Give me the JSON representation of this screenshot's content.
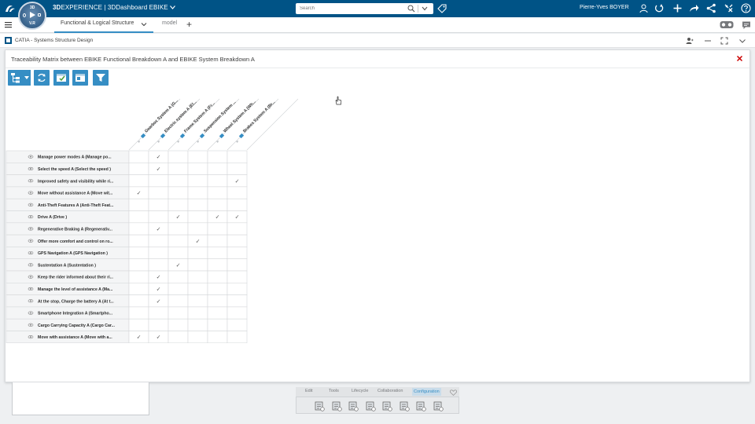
{
  "topbar": {
    "compass_labels": {
      "north": "3D",
      "west": "",
      "south": "V.R"
    },
    "brand": "3D",
    "brand_rest": "EXPERIENCE | 3DDashboard",
    "space": "EBIKE",
    "search_placeholder": "Search",
    "user": "Pierre-Yves BOYER"
  },
  "tabs": {
    "active": "Functional & Logical Structure",
    "second": "model"
  },
  "app": {
    "name": "CATIA - Systems Structure Design"
  },
  "panel": {
    "title": "Traceability Matrix between EBIKE Functional Breakdown A and EBIKE System Breakdown A"
  },
  "matrix": {
    "columns": [
      "Gearbox System A (G...",
      "Electric system A (El...",
      "Frame System A (Fr...",
      "Suspension System ...",
      "Wheel System A (Wh...",
      "Brakes System A (Br..."
    ],
    "rows": [
      {
        "label": "Manage power modes A (Manage po...",
        "checks": [
          0,
          1,
          0,
          0,
          0,
          0
        ]
      },
      {
        "label": "Select the speed A (Select the speed )",
        "checks": [
          0,
          1,
          0,
          0,
          0,
          0
        ]
      },
      {
        "label": "Improved safety and visibility while ri...",
        "checks": [
          0,
          0,
          0,
          0,
          0,
          1
        ]
      },
      {
        "label": "Move without assistance A (Move wit...",
        "checks": [
          1,
          0,
          0,
          0,
          0,
          0
        ]
      },
      {
        "label": "Anti-Theft Features A (Anti-Theft Feat...",
        "checks": [
          0,
          0,
          0,
          0,
          0,
          0
        ]
      },
      {
        "label": "Drive A (Drive )",
        "checks": [
          0,
          0,
          1,
          0,
          1,
          1
        ]
      },
      {
        "label": "Regenerative Braking A (Regenerativ...",
        "checks": [
          0,
          1,
          0,
          0,
          0,
          0
        ]
      },
      {
        "label": "Offer more comfort and control on ro...",
        "checks": [
          0,
          0,
          0,
          1,
          0,
          0
        ]
      },
      {
        "label": "GPS Navigation A (GPS Navigation )",
        "checks": [
          0,
          0,
          0,
          0,
          0,
          0
        ]
      },
      {
        "label": "Sustentation A (Sustentation )",
        "checks": [
          0,
          0,
          1,
          0,
          0,
          0
        ]
      },
      {
        "label": "Keep the rider informed about their ri...",
        "checks": [
          0,
          1,
          0,
          0,
          0,
          0
        ]
      },
      {
        "label": "Manage the level of assistance A (Ma...",
        "checks": [
          0,
          1,
          0,
          0,
          0,
          0
        ]
      },
      {
        "label": "At the stop, Charge the battery A (At t...",
        "checks": [
          0,
          1,
          0,
          0,
          0,
          0
        ]
      },
      {
        "label": "Smartphone Integration A (Smartpho...",
        "checks": [
          0,
          0,
          0,
          0,
          0,
          0
        ]
      },
      {
        "label": "Cargo Carrying Capacity A (Cargo Car...",
        "checks": [
          0,
          0,
          0,
          0,
          0,
          0
        ]
      },
      {
        "label": "Move with assistance A (Move with a...",
        "checks": [
          1,
          1,
          0,
          0,
          0,
          0
        ]
      }
    ],
    "check_glyph": "✓"
  },
  "action_bar": {
    "tabs": [
      "Edit",
      "Tools",
      "Lifecycle",
      "Collaboration",
      "Configuration"
    ],
    "active_tab": "Configuration"
  },
  "colors": {
    "topbar": "#005386",
    "accent": "#368ec4",
    "close": "#cc0000"
  },
  "icons": {
    "compass": "compass-icon",
    "search": "search-icon",
    "tag": "tag-icon",
    "user": "user-icon",
    "share": "share-icon",
    "close": "close-icon"
  }
}
